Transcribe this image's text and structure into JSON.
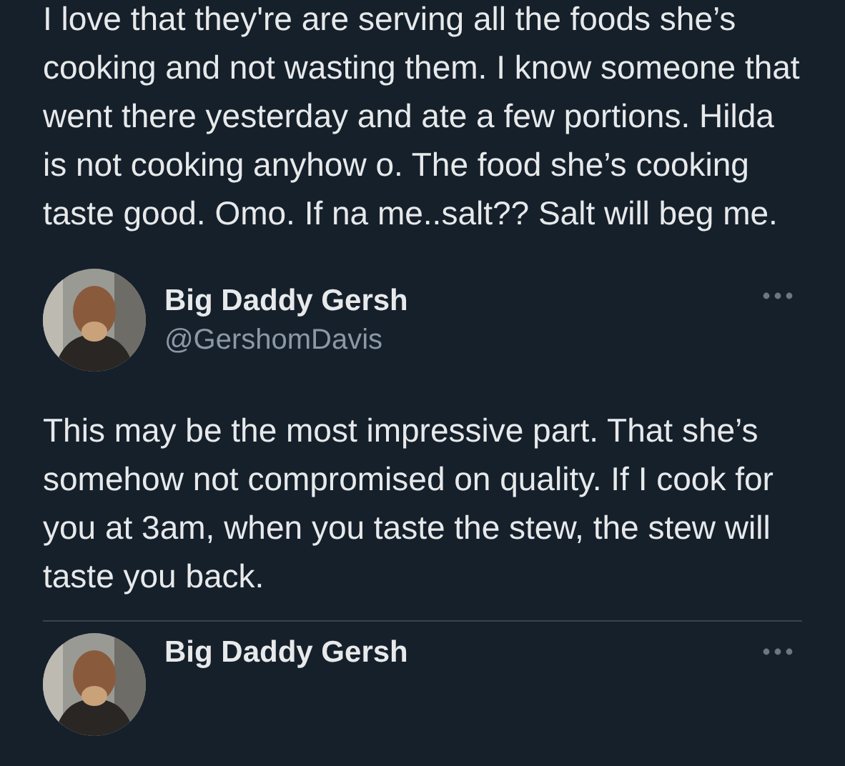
{
  "previous_text": "I love that they're are serving all the foods she’s cooking and not wasting them. I know someone that went there yesterday and ate a few portions. Hilda is not cooking anyhow o. The food she’s cooking taste good. Omo. If na me..salt?? Salt will beg me.",
  "tweets": [
    {
      "author": {
        "name": "Big Daddy Gersh",
        "handle": "@GershomDavis"
      },
      "text": "This may be the most impressive part. That she’s somehow not compromised on quality. If I cook for you at 3am, when you taste the stew, the stew will taste you back."
    },
    {
      "author": {
        "name": "Big Daddy Gersh"
      }
    }
  ]
}
